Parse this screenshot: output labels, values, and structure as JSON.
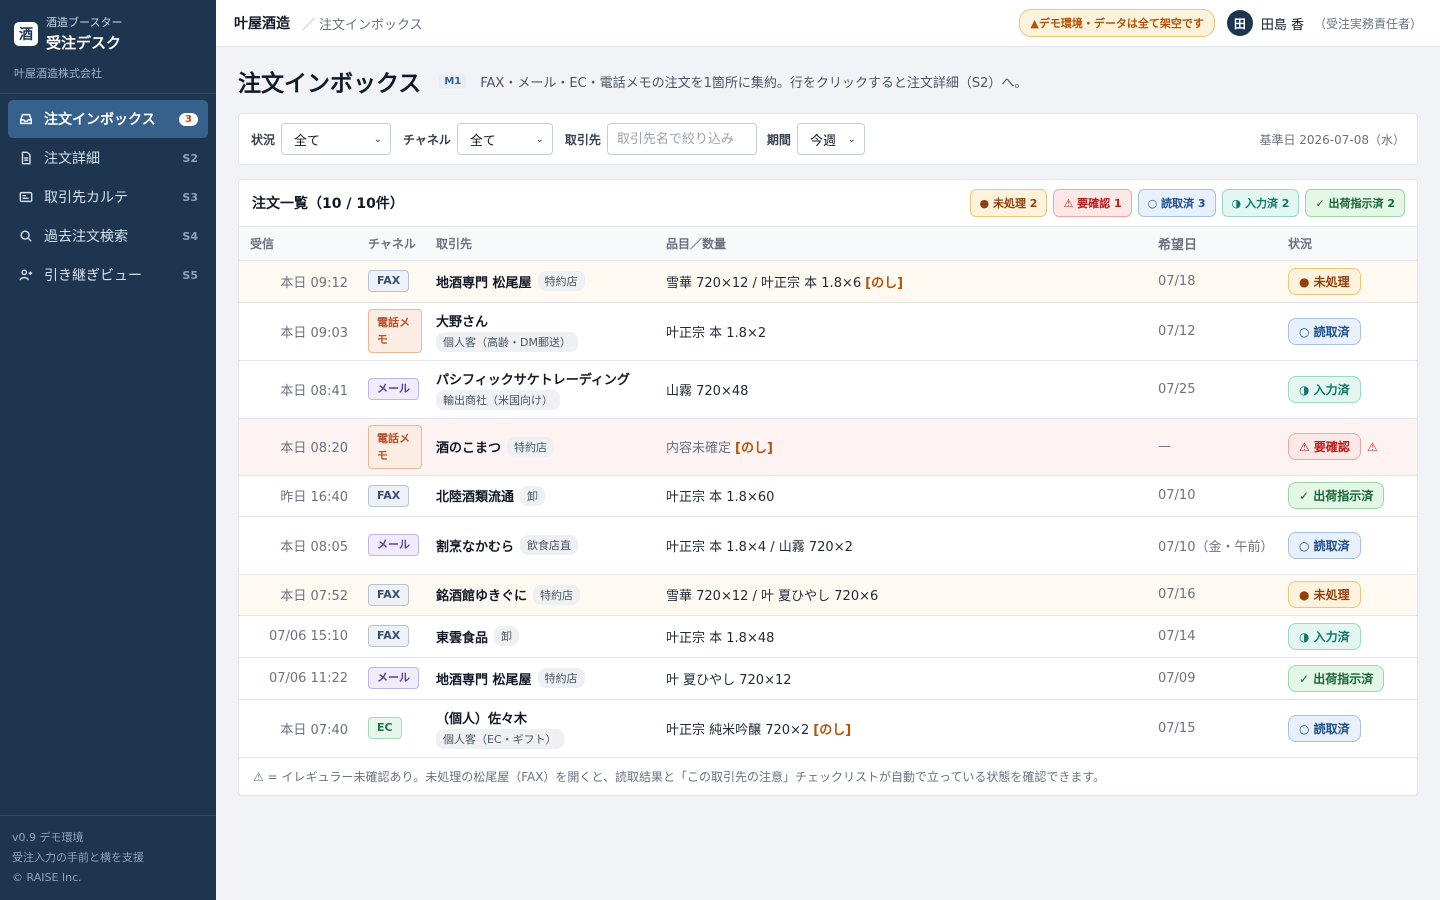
{
  "brand": {
    "logo_char": "酒",
    "sub": "酒造ブースター",
    "title": "受注デスク",
    "company": "叶屋酒造株式会社"
  },
  "nav": [
    {
      "label": "注文インボックス",
      "badge": "3",
      "icon": "inbox-icon"
    },
    {
      "label": "注文詳細",
      "code": "S2",
      "icon": "document-icon"
    },
    {
      "label": "取引先カルテ",
      "code": "S3",
      "icon": "id-card-icon"
    },
    {
      "label": "過去注文検索",
      "code": "S4",
      "icon": "search-icon"
    },
    {
      "label": "引き継ぎビュー",
      "code": "S5",
      "icon": "user-handoff-icon"
    }
  ],
  "footer": {
    "version": "v0.9 デモ環境",
    "tagline": "受注入力の手前と横を支援",
    "copyright": "© RAISE Inc."
  },
  "topbar": {
    "home": "叶屋酒造",
    "sep": "／",
    "page": "注文インボックス",
    "demo_notice": "▲デモ環境・データは全て架空です",
    "avatar_initial": "田",
    "user_name": "田島 香",
    "user_role": "（受注実務責任者）"
  },
  "page": {
    "title": "注文インボックス",
    "code": "M1",
    "description": "FAX・メール・EC・電話メモの注文を1箇所に集約。行をクリックすると注文詳細（S2）へ。"
  },
  "filters": {
    "status_label": "状況",
    "status_value": "全て",
    "channel_label": "チャネル",
    "channel_value": "全て",
    "customer_label": "取引先",
    "customer_placeholder": "取引先名で絞り込み",
    "period_label": "期間",
    "period_value": "今週",
    "base_date": "基準日 2026-07-08（水）"
  },
  "table": {
    "title": "注文一覧（10 / 10件）",
    "counts": [
      {
        "label": "● 未処理 2",
        "kind": "new"
      },
      {
        "label": "⚠ 要確認 1",
        "kind": "check"
      },
      {
        "label": "○ 読取済 3",
        "kind": "read"
      },
      {
        "label": "◑ 入力済 2",
        "kind": "input"
      },
      {
        "label": "✓ 出荷指示済 2",
        "kind": "ship"
      }
    ],
    "columns": {
      "received": "受信",
      "channel": "チャネル",
      "customer": "取引先",
      "items": "品目／数量",
      "desired": "希望日",
      "status": "状況"
    },
    "rows": [
      {
        "time": "本日 09:12",
        "channel": "FAX",
        "ch_kind": "fax",
        "customer": "地酒専門 松尾屋",
        "tag": "特約店",
        "tag_block": false,
        "items": "雪華 720×12 / 叶正宗 本 1.8×6",
        "noshi": "[のし]",
        "items_muted": false,
        "desired": "07/18",
        "status": "● 未処理",
        "st_kind": "new",
        "row_kind": "new",
        "warn": ""
      },
      {
        "time": "本日 09:03",
        "channel": "電話メモ",
        "ch_kind": "tel",
        "customer": "大野さん",
        "tag": "個人客（高齢・DM郵送）",
        "tag_block": true,
        "items": "叶正宗 本 1.8×2",
        "noshi": "",
        "items_muted": false,
        "desired": "07/12",
        "status": "○ 読取済",
        "st_kind": "read",
        "row_kind": "",
        "warn": ""
      },
      {
        "time": "本日 08:41",
        "channel": "メール",
        "ch_kind": "mail",
        "customer": "パシフィックサケトレーディング",
        "tag": "輸出商社（米国向け）",
        "tag_block": true,
        "items": "山霧 720×48",
        "noshi": "",
        "items_muted": false,
        "desired": "07/25",
        "status": "◑ 入力済",
        "st_kind": "input",
        "row_kind": "",
        "warn": ""
      },
      {
        "time": "本日 08:20",
        "channel": "電話メモ",
        "ch_kind": "tel",
        "customer": "酒のこまつ",
        "tag": "特約店",
        "tag_block": false,
        "items": "内容未確定",
        "noshi": "[のし]",
        "items_muted": true,
        "desired": "—",
        "status": "⚠ 要確認",
        "st_kind": "check",
        "row_kind": "check",
        "warn": "⚠"
      },
      {
        "time": "昨日 16:40",
        "channel": "FAX",
        "ch_kind": "fax",
        "customer": "北陸酒類流通",
        "tag": "卸",
        "tag_block": false,
        "items": "叶正宗 本 1.8×60",
        "noshi": "",
        "items_muted": false,
        "desired": "07/10",
        "status": "✓ 出荷指示済",
        "st_kind": "ship",
        "row_kind": "",
        "warn": ""
      },
      {
        "time": "本日 08:05",
        "channel": "メール",
        "ch_kind": "mail",
        "customer": "割烹なかむら",
        "tag": "飲食店直",
        "tag_block": false,
        "items": "叶正宗 本 1.8×4 / 山霧 720×2",
        "noshi": "",
        "items_muted": false,
        "desired": "07/10（金・午前）",
        "status": "○ 読取済",
        "st_kind": "read",
        "row_kind": "",
        "warn": ""
      },
      {
        "time": "本日 07:52",
        "channel": "FAX",
        "ch_kind": "fax",
        "customer": "銘酒館ゆきぐに",
        "tag": "特約店",
        "tag_block": false,
        "items": "雪華 720×12 / 叶 夏ひやし 720×6",
        "noshi": "",
        "items_muted": false,
        "desired": "07/16",
        "status": "● 未処理",
        "st_kind": "new",
        "row_kind": "new",
        "warn": ""
      },
      {
        "time": "07/06 15:10",
        "channel": "FAX",
        "ch_kind": "fax",
        "customer": "東雲食品",
        "tag": "卸",
        "tag_block": false,
        "items": "叶正宗 本 1.8×48",
        "noshi": "",
        "items_muted": false,
        "desired": "07/14",
        "status": "◑ 入力済",
        "st_kind": "input",
        "row_kind": "",
        "warn": ""
      },
      {
        "time": "07/06 11:22",
        "channel": "メール",
        "ch_kind": "mail",
        "customer": "地酒専門 松尾屋",
        "tag": "特約店",
        "tag_block": false,
        "items": "叶 夏ひやし 720×12",
        "noshi": "",
        "items_muted": false,
        "desired": "07/09",
        "status": "✓ 出荷指示済",
        "st_kind": "ship",
        "row_kind": "",
        "warn": ""
      },
      {
        "time": "本日 07:40",
        "channel": "EC",
        "ch_kind": "ec",
        "customer": "（個人）佐々木",
        "tag": "個人客（EC・ギフト）",
        "tag_block": true,
        "items": "叶正宗 純米吟醸 720×2",
        "noshi": "[のし]",
        "items_muted": false,
        "desired": "07/15",
        "status": "○ 読取済",
        "st_kind": "read",
        "row_kind": "",
        "warn": ""
      }
    ],
    "footnote": "⚠ = イレギュラー未確認あり。未処理の松尾屋（FAX）を開くと、読取結果と「この取引先の注意」チェックリストが自動で立っている状態を確認できます。"
  },
  "colors": {
    "sidebar_bg": "#1e3550",
    "nav_active": "#35618c",
    "accent_orange": "#b45309"
  }
}
